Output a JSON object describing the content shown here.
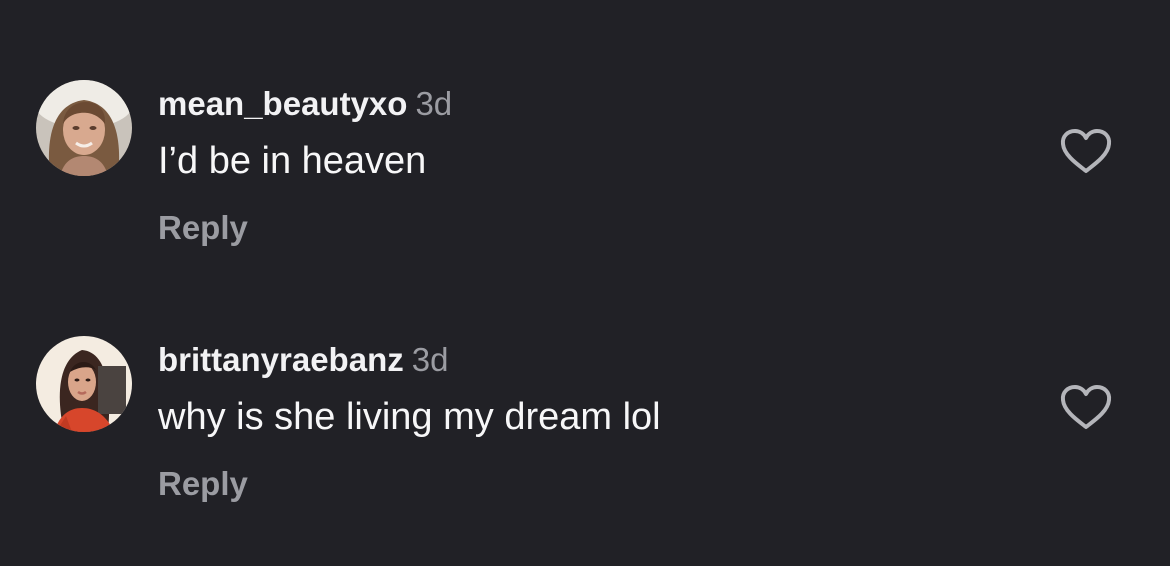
{
  "theme": {
    "background": "#212126",
    "text_primary": "#f7f7f8",
    "text_secondary": "#9b9ca2"
  },
  "comments": [
    {
      "username": "mean_beautyxo",
      "time": "3d",
      "text": "I’d be in heaven",
      "reply_label": "Reply",
      "like_icon": "heart-outline-icon"
    },
    {
      "username": "brittanyraebanz",
      "time": "3d",
      "text": "why is she living my dream lol",
      "reply_label": "Reply",
      "like_icon": "heart-outline-icon"
    }
  ]
}
